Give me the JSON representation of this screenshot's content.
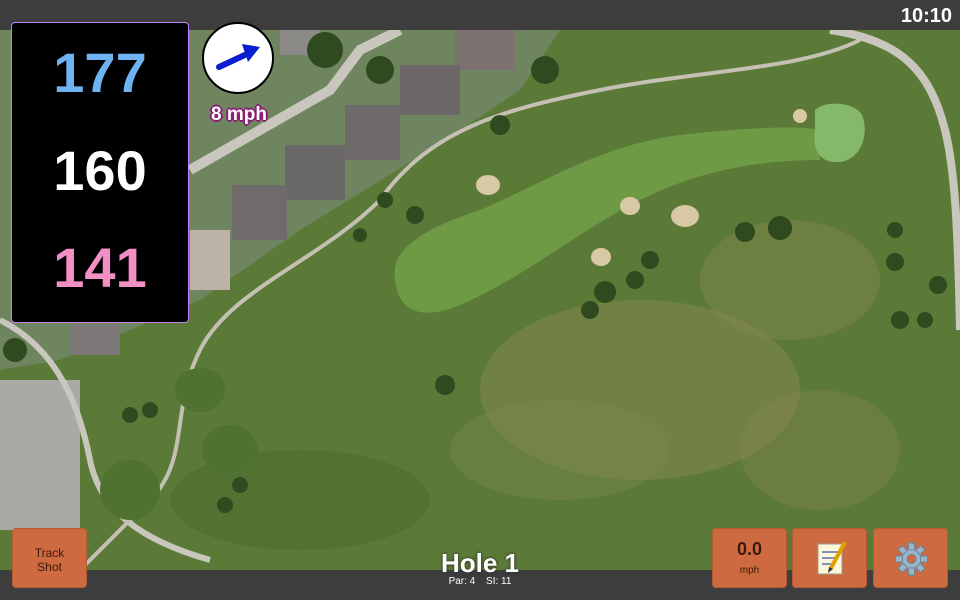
{
  "status": {
    "time": "10:10"
  },
  "distances": {
    "back": "177",
    "center": "160",
    "front": "141",
    "back_color": "#6db3f2",
    "center_color": "#ffffff",
    "front_color": "#f48fc6"
  },
  "wind": {
    "label": "8 mph",
    "icon": "arrow-right-icon"
  },
  "buttons": {
    "track_line1": "Track",
    "track_line2": "Shot",
    "speed_value": "0.0",
    "speed_unit": "mph",
    "notes_icon": "notepad-icon",
    "settings_icon": "gear-icon"
  },
  "hole": {
    "title": "Hole 1",
    "par": "Par: 4",
    "si": "SI: 11"
  },
  "colors": {
    "button": "#cd6a3f",
    "bar": "#3d3d3d",
    "accent": "#c77dff"
  }
}
